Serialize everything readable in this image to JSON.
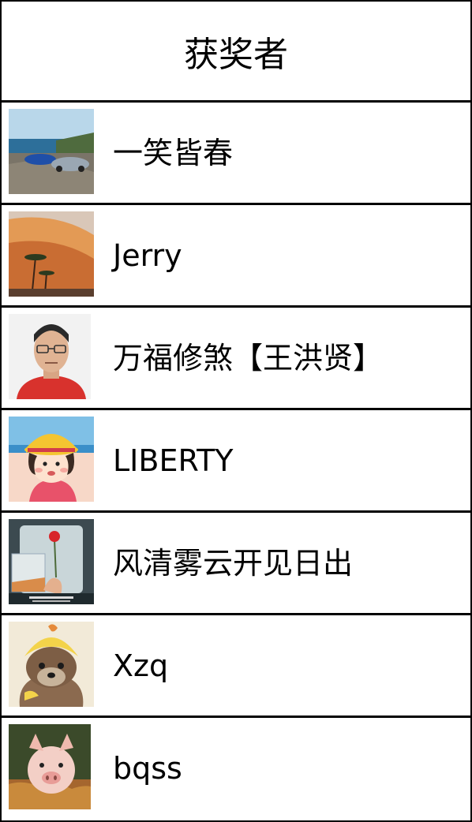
{
  "header": {
    "title": "获奖者"
  },
  "winners": [
    {
      "name": "一笑皆春",
      "avatar": "sports-cars-photo"
    },
    {
      "name": "Jerry",
      "avatar": "hotel-palm-trees-photo"
    },
    {
      "name": "万福修煞【王洪贤】",
      "avatar": "man-portrait-photo"
    },
    {
      "name": "LIBERTY",
      "avatar": "cartoon-girl-avatar"
    },
    {
      "name": "风清雾云开见日出",
      "avatar": "red-flower-photo"
    },
    {
      "name": "Xzq",
      "avatar": "otter-costume-photo"
    },
    {
      "name": "bqss",
      "avatar": "piglet-photo"
    }
  ]
}
